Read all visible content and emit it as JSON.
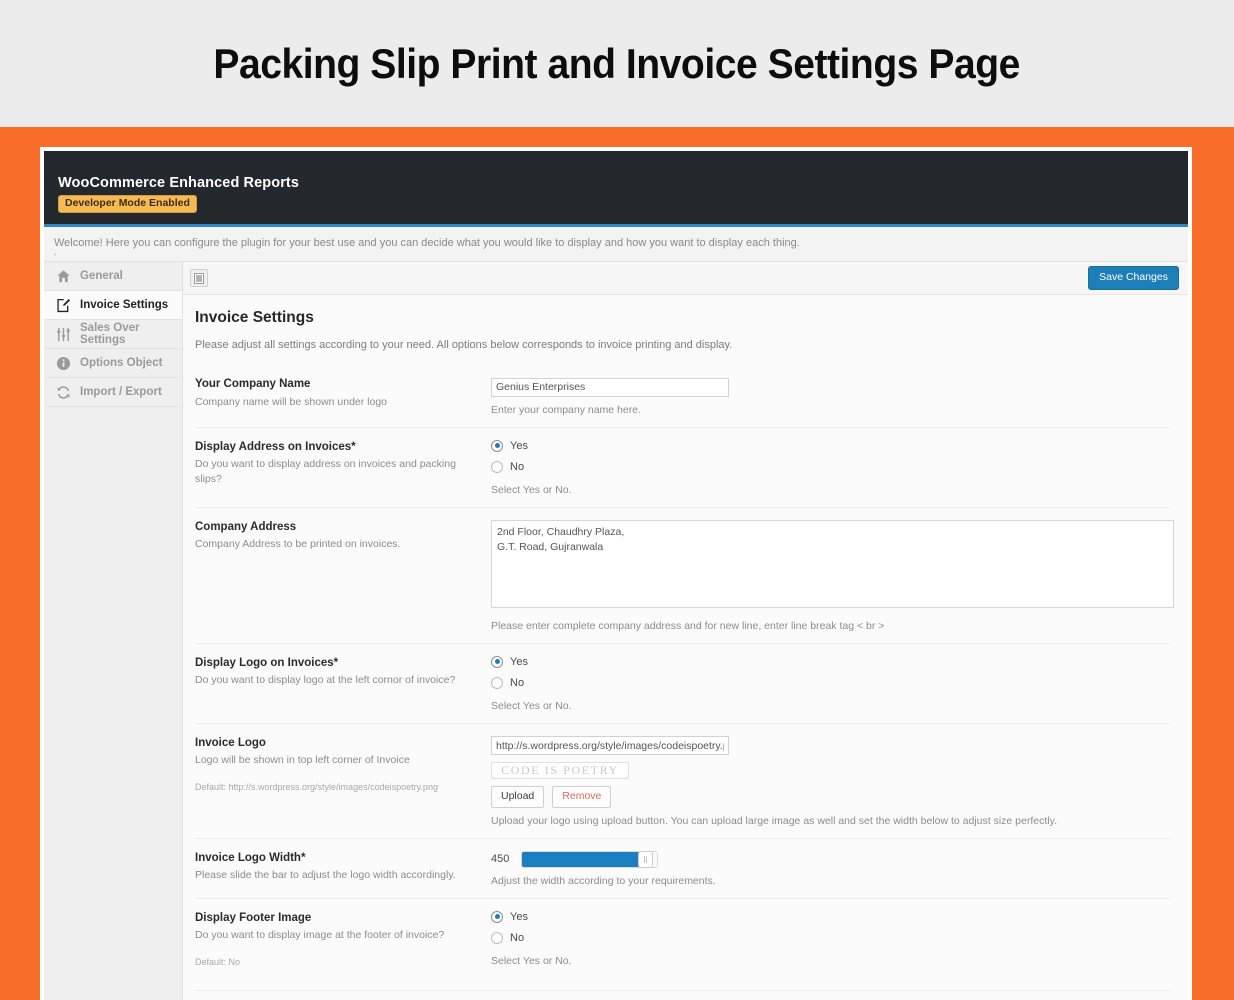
{
  "banner": {
    "title": "Packing Slip Print and Invoice Settings Page"
  },
  "plugin": {
    "name": "WooCommerce Enhanced Reports",
    "dev_badge": "Developer Mode Enabled",
    "welcome": "Welcome! Here you can configure the plugin for your best use and you can decide what you would like to display and how you want to display each thing.",
    "welcome_tiny": "'"
  },
  "colors": {
    "orange_frame": "#f96d2b",
    "header_dark": "#23282d",
    "accent_blue": "#2a8bc4",
    "button_blue": "#1e7fb8",
    "badge_amber": "#f7b955",
    "danger_red": "#e06a5a"
  },
  "sidebar": {
    "items": [
      {
        "label": "General",
        "icon": "home-icon",
        "active": false
      },
      {
        "label": "Invoice Settings",
        "icon": "edit-document-icon",
        "active": true
      },
      {
        "label": "Sales Over Settings",
        "icon": "sliders-icon",
        "active": false
      },
      {
        "label": "Options Object",
        "icon": "info-icon",
        "active": false
      },
      {
        "label": "Import / Export",
        "icon": "sync-icon",
        "active": false
      }
    ]
  },
  "toolbar": {
    "panel_toggle_icon": "panel-toggle-icon",
    "save_label": "Save Changes"
  },
  "panel": {
    "heading": "Invoice Settings",
    "intro": "Please adjust all settings according to your need. All options below corresponds to invoice printing and display."
  },
  "fields": {
    "company_name": {
      "title": "Your Company Name",
      "desc": "Company name will be shown under logo",
      "value": "Genius Enterprises",
      "hint": "Enter your company name here."
    },
    "display_address": {
      "title": "Display Address on Invoices*",
      "desc": "Do you want to display address on invoices and packing slips?",
      "options": [
        "Yes",
        "No"
      ],
      "selected": "Yes",
      "hint": "Select Yes or No."
    },
    "company_address": {
      "title": "Company Address",
      "desc": "Company Address to be printed on invoices.",
      "value": "2nd Floor, Chaudhry Plaza,\nG.T. Road, Gujranwala",
      "hint": "Please enter complete company address and for new line, enter line break tag < br >"
    },
    "display_logo": {
      "title": "Display Logo on Invoices*",
      "desc": "Do you want to display logo at the left cornor of invoice?",
      "options": [
        "Yes",
        "No"
      ],
      "selected": "Yes",
      "hint": "Select Yes or No."
    },
    "invoice_logo": {
      "title": "Invoice Logo",
      "desc": "Logo will be shown in top left corner of Invoice",
      "default_text": "Default: http://s.wordpress.org/style/images/codeispoetry.png",
      "value": "http://s.wordpress.org/style/images/codeispoetry.pn",
      "preview_text": "CODE IS POETRY",
      "upload_label": "Upload",
      "remove_label": "Remove",
      "hint": "Upload your logo using upload button. You can upload large image as well and set the width below to adjust size perfectly."
    },
    "logo_width": {
      "title": "Invoice Logo Width*",
      "desc": "Please slide the bar to adjust the logo width accordingly.",
      "value": "450",
      "fill_percent": 88,
      "hint": "Adjust the width according to your requirements."
    },
    "footer_image": {
      "title": "Display Footer Image",
      "desc": "Do you want to display image at the footer of invoice?",
      "default_text": "Default: No",
      "options": [
        "Yes",
        "No"
      ],
      "selected": "Yes",
      "hint": "Select Yes or No."
    }
  }
}
